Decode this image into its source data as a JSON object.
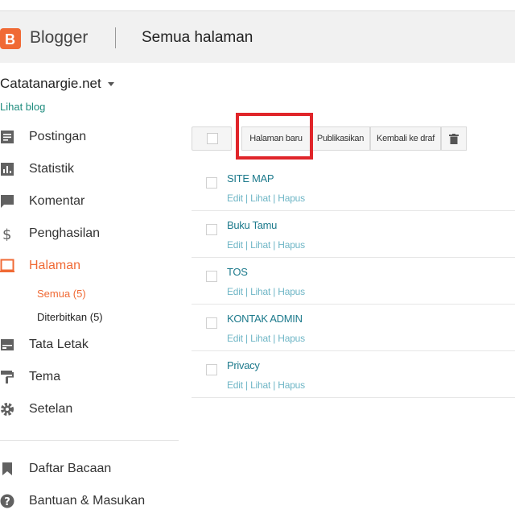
{
  "header": {
    "brand": "Blogger",
    "title": "Semua halaman"
  },
  "sidebar": {
    "blog_name": "Catatanargie.net",
    "view_blog": "Lihat blog",
    "items": [
      {
        "label": "Postingan",
        "icon": "posts-icon"
      },
      {
        "label": "Statistik",
        "icon": "stats-icon"
      },
      {
        "label": "Komentar",
        "icon": "comment-icon"
      },
      {
        "label": "Penghasilan",
        "icon": "dollar-icon"
      },
      {
        "label": "Halaman",
        "icon": "pages-icon",
        "active": true
      },
      {
        "label": "Tata Letak",
        "icon": "layout-icon"
      },
      {
        "label": "Tema",
        "icon": "paint-roller-icon"
      },
      {
        "label": "Setelan",
        "icon": "gear-icon"
      },
      {
        "label": "Daftar Bacaan",
        "icon": "bookmark-icon"
      },
      {
        "label": "Bantuan & Masukan",
        "icon": "help-icon"
      }
    ],
    "subitems": [
      {
        "label": "Semua (5)",
        "active": true
      },
      {
        "label": "Diterbitkan (5)"
      }
    ]
  },
  "toolbar": {
    "new_page": "Halaman baru",
    "publish": "Publikasikan",
    "revert": "Kembali ke draf"
  },
  "pages": [
    {
      "title": "SITE MAP",
      "actions": "Edit | Lihat | Hapus"
    },
    {
      "title": "Buku Tamu",
      "actions": "Edit | Lihat | Hapus"
    },
    {
      "title": "TOS",
      "actions": "Edit | Lihat | Hapus"
    },
    {
      "title": "KONTAK ADMIN",
      "actions": "Edit | Lihat | Hapus"
    },
    {
      "title": "Privacy",
      "actions": "Edit | Lihat | Hapus"
    }
  ],
  "colors": {
    "accent": "#f06a35",
    "link": "#1d7a8c",
    "highlight": "#e0252a"
  }
}
